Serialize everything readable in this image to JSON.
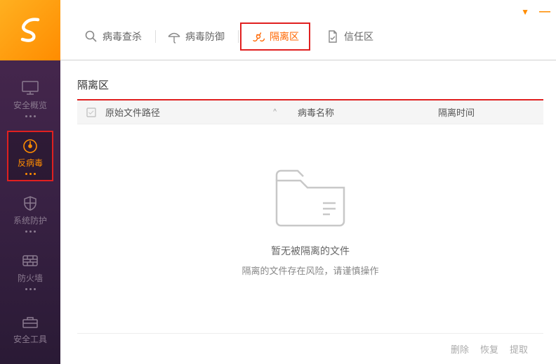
{
  "window": {
    "menu_glyph": "▼",
    "min_glyph": "—"
  },
  "sidebar": {
    "items": [
      {
        "label": "安全概览",
        "icon": "monitor"
      },
      {
        "label": "反病毒",
        "icon": "gauge"
      },
      {
        "label": "系统防护",
        "icon": "shield"
      },
      {
        "label": "防火墙",
        "icon": "firewall"
      },
      {
        "label": "安全工具",
        "icon": "toolbox"
      }
    ]
  },
  "tabs": [
    {
      "label": "病毒查杀",
      "icon": "search"
    },
    {
      "label": "病毒防御",
      "icon": "umbrella"
    },
    {
      "label": "隔离区",
      "icon": "biohazard"
    },
    {
      "label": "信任区",
      "icon": "doc-check"
    }
  ],
  "panel": {
    "title": "隔离区",
    "columns": {
      "c1": "原始文件路径",
      "c2": "病毒名称",
      "c3": "隔离时间"
    },
    "sort_glyph": "^",
    "empty": {
      "line1": "暂无被隔离的文件",
      "line2": "隔离的文件存在风险，请谨慎操作"
    }
  },
  "footer": {
    "delete": "删除",
    "restore": "恢复",
    "extract": "提取"
  }
}
